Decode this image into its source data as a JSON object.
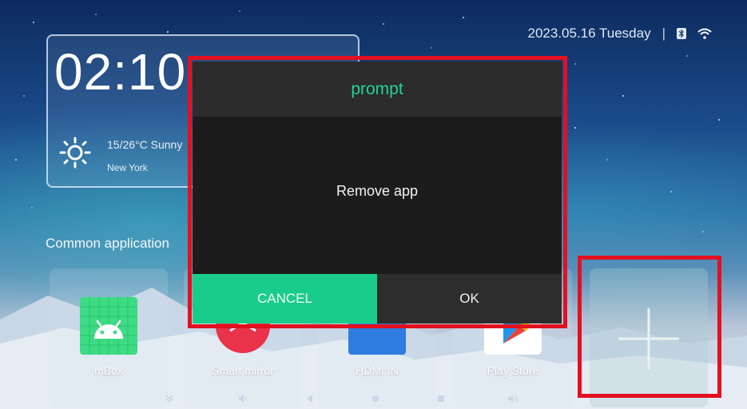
{
  "status": {
    "date": "2023.05.16 Tuesday",
    "separator": "|",
    "icons": [
      "bluetooth-icon",
      "wifi-icon"
    ]
  },
  "clock": {
    "time": "02:10",
    "weather_temp": "15/26°C Sunny",
    "city": "New York",
    "weather_icon": "sun-icon"
  },
  "section_title": "Common application",
  "apps": [
    {
      "label": "mBox",
      "icon": "android-icon"
    },
    {
      "label": "Smart mirror",
      "icon": "smart-mirror-icon"
    },
    {
      "label": "HDMI IN",
      "icon": "hdmi-icon"
    },
    {
      "label": "Play Store",
      "icon": "play-store-icon"
    }
  ],
  "add_tile_icon": "plus-icon",
  "nav": [
    "collapse-icon",
    "volume-down-icon",
    "back-icon",
    "home-icon",
    "recent-icon",
    "volume-up-icon"
  ],
  "dialog": {
    "title": "prompt",
    "message": "Remove app",
    "cancel_label": "CANCEL",
    "ok_label": "OK"
  },
  "colors": {
    "accent": "#1ed59a",
    "cancel_bg": "#19cc8b",
    "highlight": "#e3101f",
    "dialog_bg": "#1c1c1c",
    "dialog_header_bg": "#2c2c2c"
  }
}
